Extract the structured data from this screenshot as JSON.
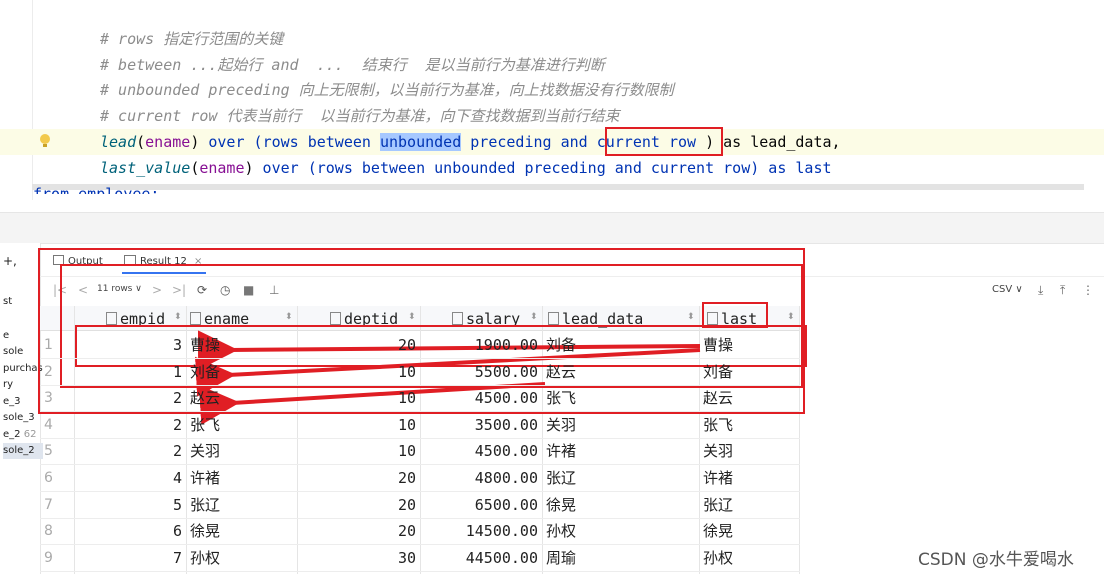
{
  "editor": {
    "comment_lines": [
      "# rows 指定行范围的关键",
      "# between ...起始行 and  ...  结束行  是以当前行为基准进行判断",
      "# unbounded preceding 向上无限制，以当前行为基准，向上找数据没有行数限制",
      "# current row 代表当前行  以当前行为基准，向下查找数据到当前行结束"
    ],
    "line5": {
      "fn": "lead",
      "arg": "ename",
      "over": "over (",
      "rows_between": "rows between ",
      "unbounded": "unbounded",
      "preceding_and": " preceding and ",
      "current_row": "current row",
      "tail": " ) as lead_data,"
    },
    "line6": {
      "fn": "last_value",
      "arg": "ename",
      "over": " over (rows between unbounded preceding and current row) as last"
    },
    "cut_line": "from employee;"
  },
  "left_panel": {
    "items": [
      "st",
      "e",
      "sole",
      "purchas",
      "ry",
      "e_3",
      "sole_3",
      "e_2",
      "sole_2"
    ],
    "item_e2_suffix": "62",
    "toolbar_plus": "+,"
  },
  "tabs": {
    "output": "Output",
    "result": "Result 12",
    "result_close": "×"
  },
  "toolbar": {
    "rows_label": "11 rows ∨",
    "csv_label": "CSV ∨",
    "nav_icons": [
      "|<",
      "<",
      ">",
      ">|"
    ]
  },
  "grid": {
    "columns": [
      "empid",
      "ename",
      "deptid",
      "salary",
      "lead_data",
      "last"
    ],
    "rows": [
      {
        "n": "1",
        "empid": "3",
        "ename": "曹操",
        "deptid": "20",
        "salary": "1900.00",
        "lead": "刘备",
        "last": "曹操"
      },
      {
        "n": "2",
        "empid": "1",
        "ename": "刘备",
        "deptid": "10",
        "salary": "5500.00",
        "lead": "赵云",
        "last": "刘备"
      },
      {
        "n": "3",
        "empid": "2",
        "ename": "赵云",
        "deptid": "10",
        "salary": "4500.00",
        "lead": "张飞",
        "last": "赵云"
      },
      {
        "n": "4",
        "empid": "2",
        "ename": "张飞",
        "deptid": "10",
        "salary": "3500.00",
        "lead": "关羽",
        "last": "张飞"
      },
      {
        "n": "5",
        "empid": "2",
        "ename": "关羽",
        "deptid": "10",
        "salary": "4500.00",
        "lead": "许褚",
        "last": "关羽"
      },
      {
        "n": "6",
        "empid": "4",
        "ename": "许褚",
        "deptid": "20",
        "salary": "4800.00",
        "lead": "张辽",
        "last": "许褚"
      },
      {
        "n": "7",
        "empid": "5",
        "ename": "张辽",
        "deptid": "20",
        "salary": "6500.00",
        "lead": "徐晃",
        "last": "张辽"
      },
      {
        "n": "8",
        "empid": "6",
        "ename": "徐晃",
        "deptid": "20",
        "salary": "14500.00",
        "lead": "孙权",
        "last": "徐晃"
      },
      {
        "n": "9",
        "empid": "7",
        "ename": "孙权",
        "deptid": "30",
        "salary": "44500.00",
        "lead": "周瑜",
        "last": "孙权"
      }
    ]
  },
  "colors": {
    "annotation": "#e01e24",
    "keyword": "#0033b3",
    "comment": "#8c8c8c"
  },
  "watermark": "CSDN @水牛爱喝水"
}
